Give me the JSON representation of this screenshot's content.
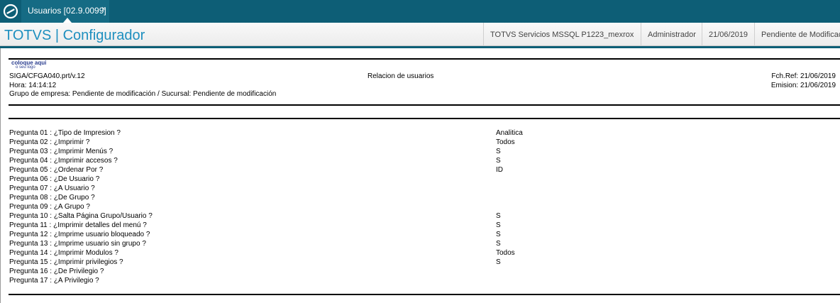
{
  "tab": {
    "label": "Usuarios [02.9.0099]",
    "close": "×"
  },
  "header": {
    "brand": "TOTVS | Configurador",
    "environment": "TOTVS Servicios MSSQL P1223_mexrox",
    "user": "Administrador",
    "date": "21/06/2019",
    "status": "Pendiente de Modificac"
  },
  "report": {
    "logo_line1": "coloque aqui",
    "logo_line2": "o seu logo",
    "program": "SIGA/CFGA040.prt/v.12",
    "title": "Relacion de usuarios",
    "fch_ref": "Fch.Ref: 21/06/2019",
    "hora": "Hora: 14:14:12",
    "emision": "Emision: 21/06/2019",
    "group": "Grupo de empresa: Pendiente de modificación / Sucursal: Pendiente de modificación",
    "questions": [
      {
        "label": "Pregunta 01 : ¿Tipo de Impresion ?",
        "answer": "Analitica"
      },
      {
        "label": "Pregunta 02 : ¿Imprimir ?",
        "answer": "Todos"
      },
      {
        "label": "Pregunta 03 : ¿Imprimir Menús ?",
        "answer": "S"
      },
      {
        "label": "Pregunta 04 : ¿Imprimir accesos ?",
        "answer": "S"
      },
      {
        "label": "Pregunta 05 : ¿Ordenar Por ?",
        "answer": "ID"
      },
      {
        "label": "Pregunta 06 : ¿De Usuario ?",
        "answer": ""
      },
      {
        "label": "Pregunta 07 : ¿A Usuario ?",
        "answer": ""
      },
      {
        "label": "Pregunta 08 : ¿De Grupo ?",
        "answer": ""
      },
      {
        "label": "Pregunta 09 : ¿A Grupo ?",
        "answer": ""
      },
      {
        "label": "Pregunta 10 : ¿Salta Página Grupo/Usuario ?",
        "answer": "S"
      },
      {
        "label": "Pregunta 11 : ¿Imprimir detalles del menú ?",
        "answer": "S"
      },
      {
        "label": "Pregunta 12 : ¿Imprime usuario bloqueado ?",
        "answer": "S"
      },
      {
        "label": "Pregunta 13 : ¿Imprime usuario sin grupo ?",
        "answer": "S"
      },
      {
        "label": "Pregunta 14 : ¿Imprimir Modulos ?",
        "answer": "Todos"
      },
      {
        "label": "Pregunta 15 : ¿Imprimir privilegios ?",
        "answer": "S"
      },
      {
        "label": "Pregunta 16 : ¿De Privilegio ?",
        "answer": ""
      },
      {
        "label": "Pregunta 17 : ¿A Privilegio ?",
        "answer": ""
      }
    ]
  },
  "colors": {
    "topbar": "#0d5e76",
    "tab": "#156b84",
    "brand": "#1e8fbf"
  },
  "icons": {
    "app": "totvs-logo-icon",
    "close": "close-icon"
  }
}
